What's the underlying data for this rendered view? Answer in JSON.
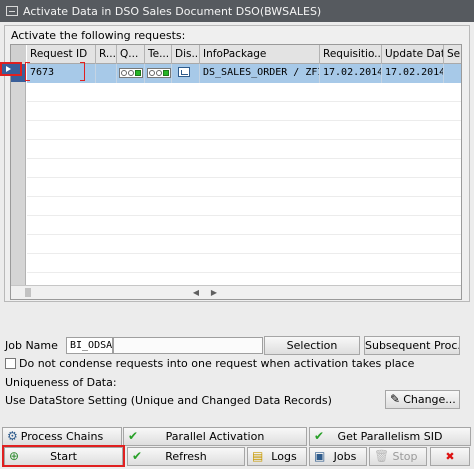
{
  "window": {
    "title": "Activate Data in DSO Sales Document DSO(BWSALES)"
  },
  "group": {
    "title": "Activate the following requests:"
  },
  "table": {
    "columns": [
      "Request ID",
      "R...",
      "Q...",
      "Te...",
      "Dis...",
      "InfoPackage",
      "Requisitio...",
      "Update Date",
      "Se"
    ],
    "rows": [
      {
        "request_id": "7673",
        "r": "",
        "infopackage": "DS_SALES_ORDER / ZFIL...",
        "requisition_date": "17.02.2014",
        "update_date": "17.02.2014",
        "se": ""
      }
    ],
    "scroll_left_arrow": "◀",
    "scroll_right_arrow": "▶"
  },
  "form": {
    "job_name_label": "Job Name",
    "job_name_value": "BI_ODSA",
    "selection_button": "Selection",
    "subsequent_button": "Subsequent Proc.",
    "no_condense_label": "Do not condense requests into one request when activation takes place",
    "uniqueness_label": "Uniqueness of Data:",
    "datastore_setting_text": "Use DataStore Setting (Unique and Changed Data Records)",
    "change_button": "Change..."
  },
  "buttons": {
    "process_chains": "Process Chains",
    "parallel_activation": "Parallel Activation",
    "get_parallelism_sid": "Get Parallelism SID",
    "start": "Start",
    "refresh": "Refresh",
    "logs": "Logs",
    "jobs": "Jobs",
    "stop": "Stop"
  },
  "colors": {
    "title_bar": "#565a5f",
    "selected_row": "#a7c9e8",
    "highlight": "#e02020",
    "green": "#28a028"
  }
}
